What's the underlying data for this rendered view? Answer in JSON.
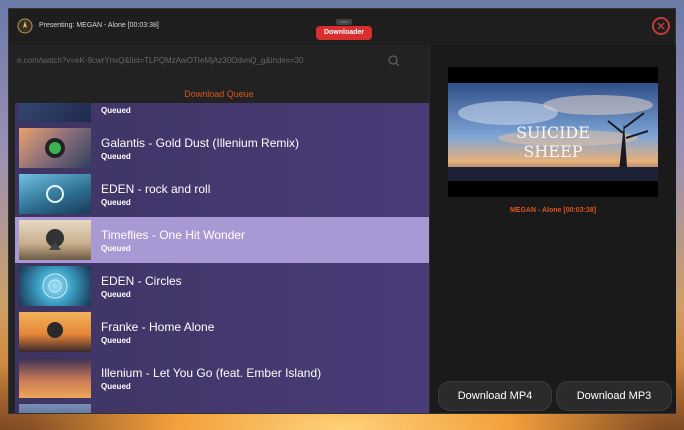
{
  "window": {
    "title": "Presenting: MEGAN - Alone [00:03:38]",
    "badge": "Downloader"
  },
  "search": {
    "url_value": "e.com/watch?v=eK-9cwrYnvQ&list=TLPQMzAwOTIeMjAz30OdvnQ_g&index=30"
  },
  "queue": {
    "title": "Download Queue",
    "items": [
      {
        "title": "",
        "status": "Queued",
        "thumb_colors": [
          "#3a4d7c",
          "#1f2a4a"
        ]
      },
      {
        "title": "Galantis - Gold Dust (Illenium Remix)",
        "status": "Queued",
        "thumb_colors": [
          "#e9a26b",
          "#2f3f5e"
        ]
      },
      {
        "title": "EDEN - rock and roll",
        "status": "Queued",
        "thumb_colors": [
          "#4d9ec4",
          "#1a3a55"
        ]
      },
      {
        "title": "Timeflies - One Hit Wonder",
        "status": "Queued",
        "thumb_colors": [
          "#d9c3a5",
          "#6b5a45"
        ]
      },
      {
        "title": "EDEN - Circles",
        "status": "Queued",
        "thumb_colors": [
          "#3ea2c8",
          "#16344e"
        ]
      },
      {
        "title": "Franke - Home Alone",
        "status": "Queued",
        "thumb_colors": [
          "#e6873a",
          "#3a2a2a"
        ]
      },
      {
        "title": "Illenium - Let You Go (feat. Ember Island)",
        "status": "Queued",
        "thumb_colors": [
          "#f0a65a",
          "#3b3155"
        ]
      },
      {
        "title": "",
        "status": "",
        "thumb_colors": [
          "#7a8fb8",
          "#2b3550"
        ]
      }
    ]
  },
  "player": {
    "now_playing": "MEGAN - Alone [00:03:38]"
  },
  "buttons": {
    "download_mp4": "Download MP4",
    "download_mp3": "Download MP3"
  },
  "colors": {
    "accent_orange": "#d8561c",
    "badge_red": "#d92e2e",
    "row_bg": "#453a70",
    "row_selected": "#a898d4"
  }
}
